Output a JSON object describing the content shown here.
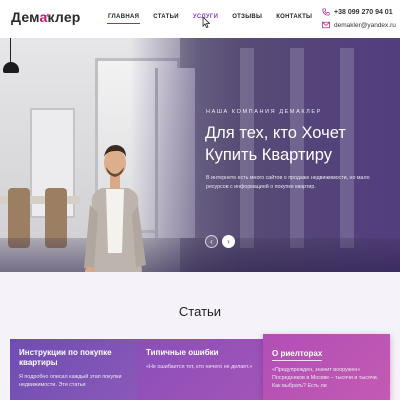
{
  "header": {
    "logo_left": "Дем",
    "logo_accent": "а",
    "logo_right": "клер",
    "nav": [
      {
        "label": "Главная"
      },
      {
        "label": "Статьи"
      },
      {
        "label": "Услуги"
      },
      {
        "label": "Отзывы"
      },
      {
        "label": "Контакты"
      }
    ],
    "phone": "+38 099 270 94 01",
    "email": "demakler@yandex.ru"
  },
  "hero": {
    "kicker": "Наша компания Демаклер",
    "title": "Для тех, кто Хочет Купить Квартиру",
    "text": "В интернете есть много сайтов о продаже недвижимости, но мало ресурсов с информацией о покупке квартир.",
    "prev_icon": "‹",
    "next_icon": "›"
  },
  "articles": {
    "title": "Статьи",
    "cards": [
      {
        "title": "Инструкции по покупке квартиры",
        "text": "Я подробно описал каждый этап покупки недвижимости. Эти статьи"
      },
      {
        "title": "Типичные ошибки",
        "text": "«Не ошибается тот, кто ничего не делает.»"
      },
      {
        "title": "О риелторах",
        "text": "«Предупрежден, значит вооружен»\nПосредников в Москве – тысячи и тысячи. Как выбрать? Есть ли"
      }
    ]
  },
  "colors": {
    "accent": "#c2187a",
    "nav_active_underline": "#6a3fa8",
    "card_1": "#6e4db3",
    "card_2": "#8a4fb9",
    "card_3": "#b14fb6"
  },
  "icons": {
    "phone": "phone-icon",
    "mail": "mail-icon",
    "cursor": "pointer-cursor-icon"
  }
}
